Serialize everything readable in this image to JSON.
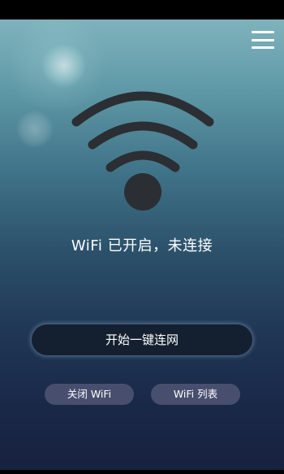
{
  "header": {
    "menu_icon": "hamburger-menu-icon"
  },
  "main": {
    "wifi_icon": "wifi-signal-icon",
    "status_text": "WiFi 已开启，未连接",
    "connect_button_label": "开始一键连网",
    "close_wifi_label": "关闭 WiFi",
    "wifi_list_label": "WiFi 列表"
  },
  "colors": {
    "icon": "#2b2e33",
    "text": "#ffffff",
    "button_dark": "#141e2d",
    "button_pill": "#6e6e8c"
  }
}
